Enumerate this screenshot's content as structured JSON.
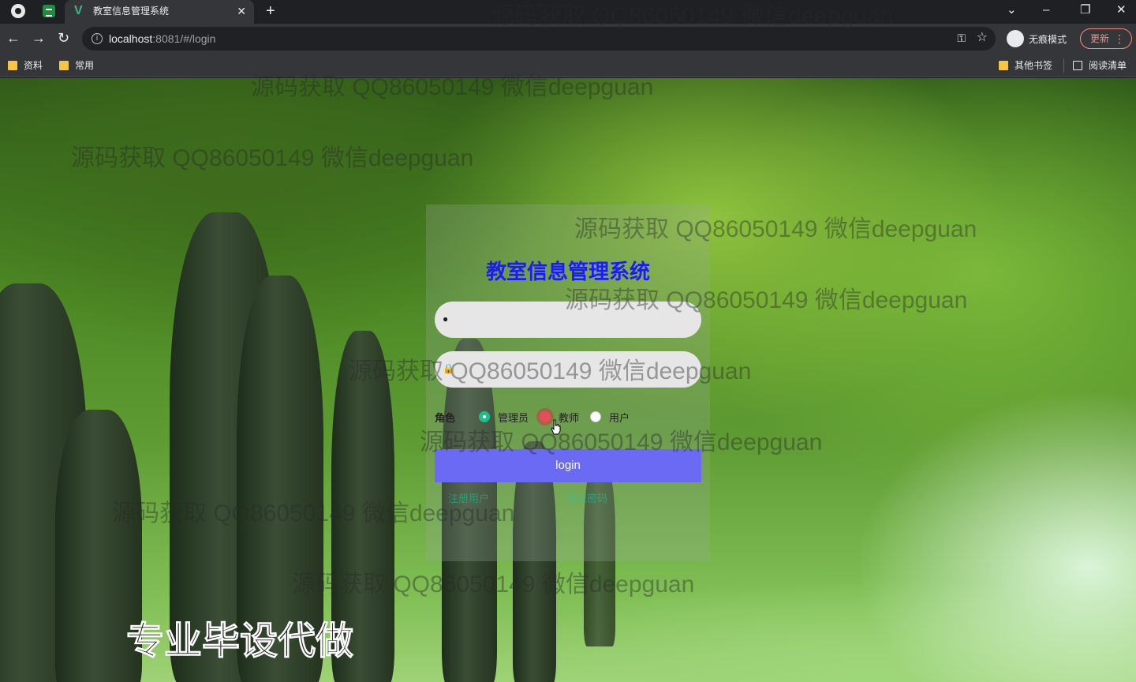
{
  "browser": {
    "tab_title": "教室信息管理系统",
    "url_host": "localhost",
    "url_rest": ":8081/#/login",
    "incognito_label": "无痕模式",
    "update_label": "更新",
    "bookmarks": [
      "资料",
      "常用"
    ],
    "bookmarks_right": [
      "其他书签",
      "阅读清单"
    ]
  },
  "login": {
    "title": "教室信息管理系统",
    "username": {
      "value": "",
      "placeholder": ""
    },
    "password": {
      "value": "",
      "placeholder": ""
    },
    "role_label": "角色",
    "roles": [
      "管理员",
      "教师",
      "用户"
    ],
    "selected_role": "管理员",
    "button_label": "login",
    "links": [
      "注册用户",
      "忘记密码"
    ]
  },
  "watermark_text": "源码获取 QQ86050149 微信deepguan",
  "promo_text": "专业毕设代做",
  "colors": {
    "title": "#1a1aff",
    "login_button": "#6a6af5",
    "radio_checked": "#1ec08a"
  }
}
